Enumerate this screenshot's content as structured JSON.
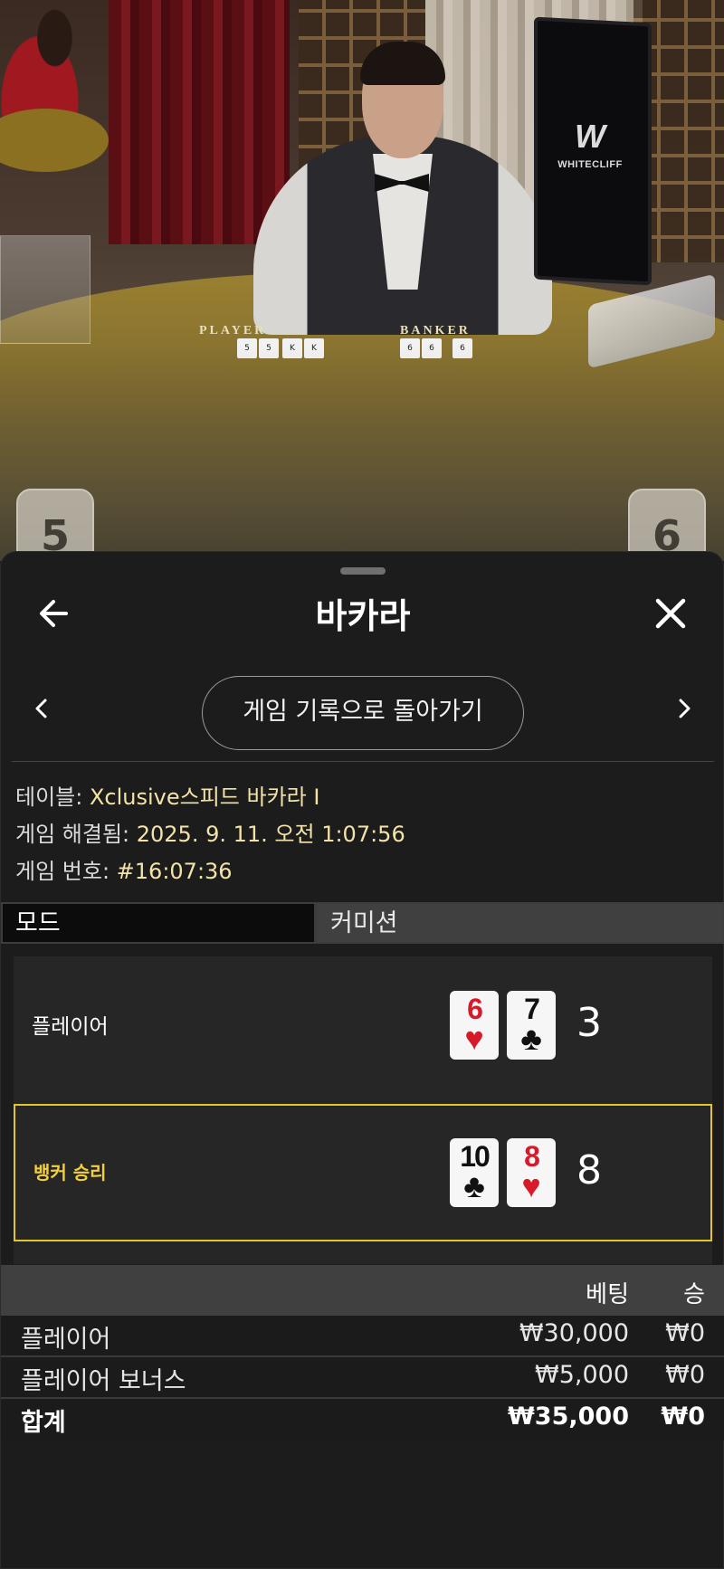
{
  "video": {
    "felt_player_label": "PLAYER",
    "felt_banker_label": "BANKER",
    "monitor_brand": "WHITECLIFF",
    "player_score_tile": "5",
    "banker_score_tile": "6"
  },
  "header": {
    "title": "바카라",
    "back_icon": "arrow-left-icon",
    "close_icon": "close-icon"
  },
  "nav": {
    "history_button": "게임 기록으로 돌아가기",
    "prev_icon": "chevron-left-icon",
    "next_icon": "chevron-right-icon"
  },
  "info": {
    "table_label": "테이블: ",
    "table_value": "Xclusive스피드 바카라 I",
    "resolved_label": "게임 해결됨: ",
    "resolved_value": "2025. 9. 11. 오전 1:07:56",
    "number_label": "게임 번호: ",
    "number_value": "#16:07:36"
  },
  "tabs": {
    "mode": "모드",
    "commission": "커미션"
  },
  "round": {
    "player": {
      "label": "플레이어",
      "cards": [
        {
          "rank": "6",
          "suit": "♥",
          "color": "#d71a2a"
        },
        {
          "rank": "7",
          "suit": "♣",
          "color": "#111111"
        }
      ],
      "score": "3"
    },
    "banker": {
      "label": "뱅커 승리",
      "cards": [
        {
          "rank": "10",
          "suit": "♣",
          "color": "#111111"
        },
        {
          "rank": "8",
          "suit": "♥",
          "color": "#d71a2a"
        }
      ],
      "score": "8",
      "highlight_color": "#e1c52b"
    }
  },
  "bets": {
    "col_bet": "베팅",
    "col_win": "승",
    "rows": [
      {
        "name": "플레이어",
        "bet": "₩30,000",
        "win": "₩0"
      },
      {
        "name": "플레이어 보너스",
        "bet": "₩5,000",
        "win": "₩0"
      }
    ],
    "total": {
      "name": "합계",
      "bet": "₩35,000",
      "win": "₩0"
    }
  }
}
